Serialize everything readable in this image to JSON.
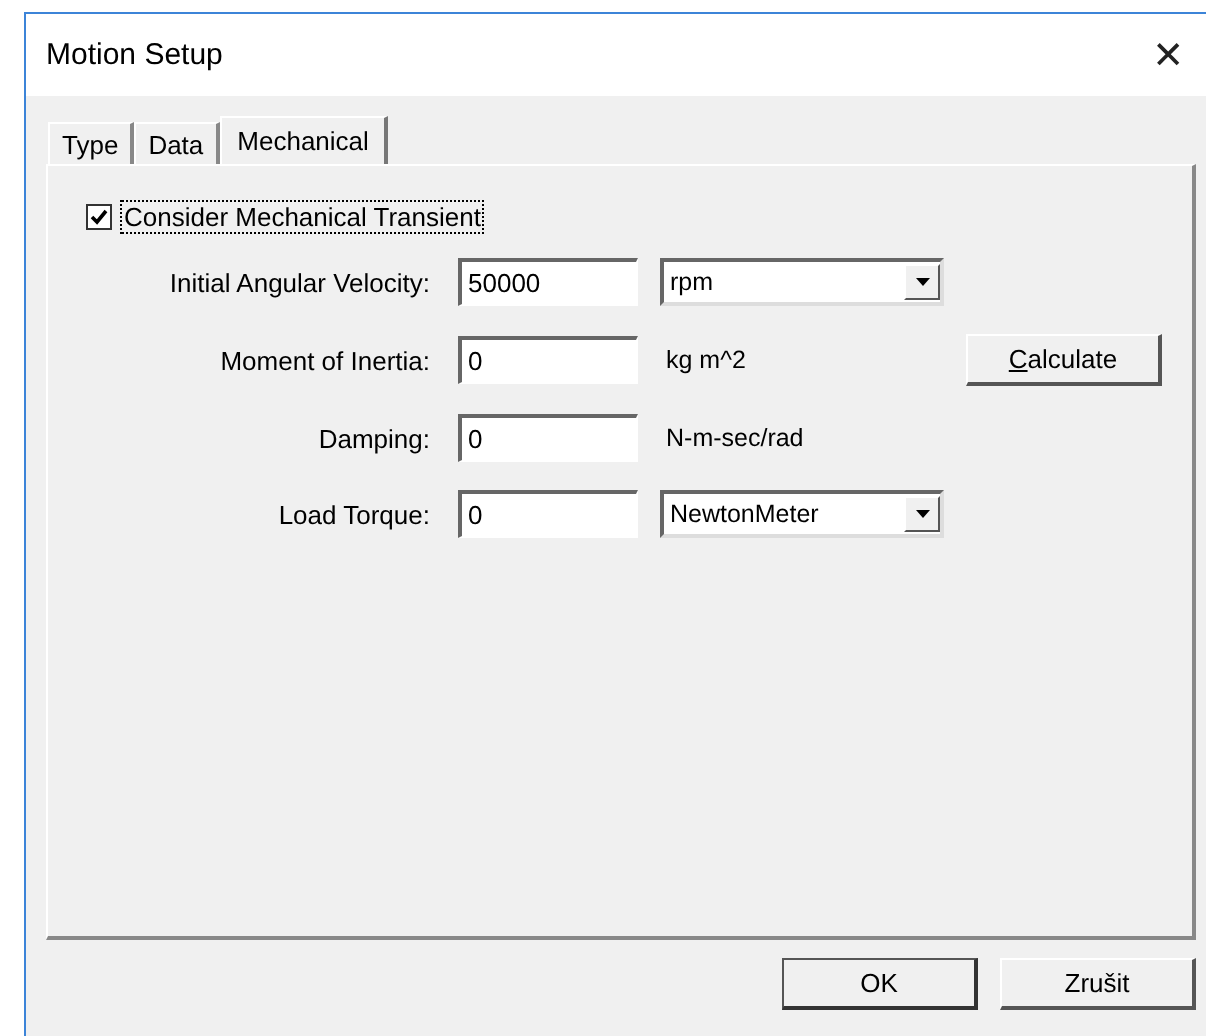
{
  "window": {
    "title": "Motion Setup",
    "close": "✕"
  },
  "tabs": [
    {
      "label": "Type",
      "selected": false
    },
    {
      "label": "Data",
      "selected": false
    },
    {
      "label": "Mechanical",
      "selected": true
    }
  ],
  "checkbox": {
    "label": "Consider Mechanical Transient",
    "checked": true,
    "focused": true
  },
  "fields": [
    {
      "label": "Initial Angular Velocity:",
      "value": "50000",
      "unit": {
        "kind": "dropdown",
        "text": "rpm"
      }
    },
    {
      "label": "Moment of Inertia:",
      "value": "0",
      "unit": {
        "kind": "label",
        "text": "kg m^2"
      },
      "button": "Calculate"
    },
    {
      "label": "Damping:",
      "value": "0",
      "unit": {
        "kind": "label",
        "text": "N-m-sec/rad"
      }
    },
    {
      "label": "Load Torque:",
      "value": "0",
      "unit": {
        "kind": "dropdown",
        "text": "NewtonMeter"
      }
    }
  ],
  "buttons": [
    "OK",
    "Zrušit"
  ]
}
